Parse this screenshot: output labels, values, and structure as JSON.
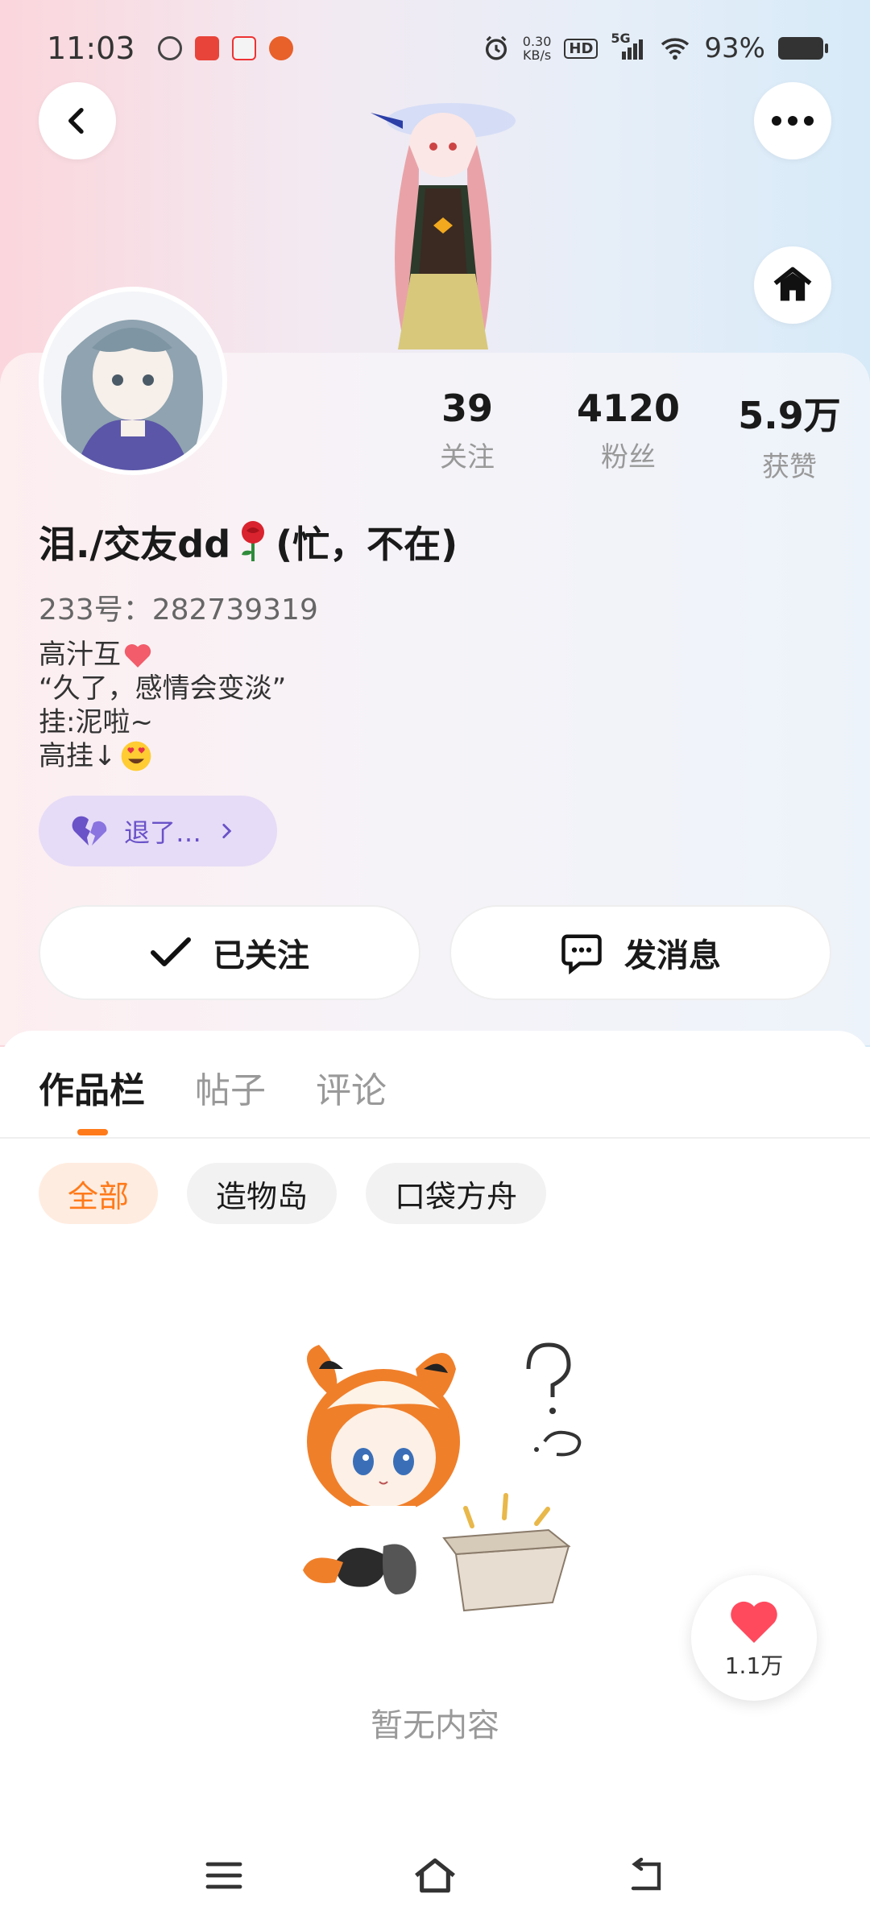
{
  "status_bar": {
    "time": "11:03",
    "net_speed_value": "0.30",
    "net_speed_unit": "KB/s",
    "hd": "HD",
    "signal": "5G",
    "battery": "93%",
    "icons": [
      "alarm-icon",
      "hd-icon",
      "signal-5g-icon",
      "wifi-icon",
      "battery-icon"
    ]
  },
  "header": {
    "back_icon": "chevron-left-icon",
    "more_icon": "more-dots-icon",
    "home_icon": "home-icon"
  },
  "profile": {
    "stats": [
      {
        "value": "39",
        "label": "关注"
      },
      {
        "value": "4120",
        "label": "粉丝"
      },
      {
        "value": "5.9万",
        "label": "获赞"
      }
    ],
    "name_prefix": "泪./交友dd",
    "name_suffix": "(忙，不在)",
    "uid": "233号：282739319",
    "bio": {
      "line1": "高汁互",
      "line2": "“久了，感情会变淡”",
      "line3": "挂:泥啦~",
      "line4": "高挂↓"
    },
    "tag_label": "退了…",
    "follow_label": "已关注",
    "message_label": "发消息"
  },
  "tabs": [
    {
      "label": "作品栏",
      "active": true
    },
    {
      "label": "帖子",
      "active": false
    },
    {
      "label": "评论",
      "active": false
    }
  ],
  "chips": [
    {
      "label": "全部",
      "active": true
    },
    {
      "label": "造物岛",
      "active": false
    },
    {
      "label": "口袋方舟",
      "active": false
    }
  ],
  "empty": {
    "text": "暂无内容"
  },
  "like_fab": {
    "count": "1.1万"
  },
  "colors": {
    "accent": "#ff7a1a",
    "tag_bg": "#e6dcf7",
    "tag_text": "#6a52c8",
    "heart": "#ff4a5e"
  }
}
